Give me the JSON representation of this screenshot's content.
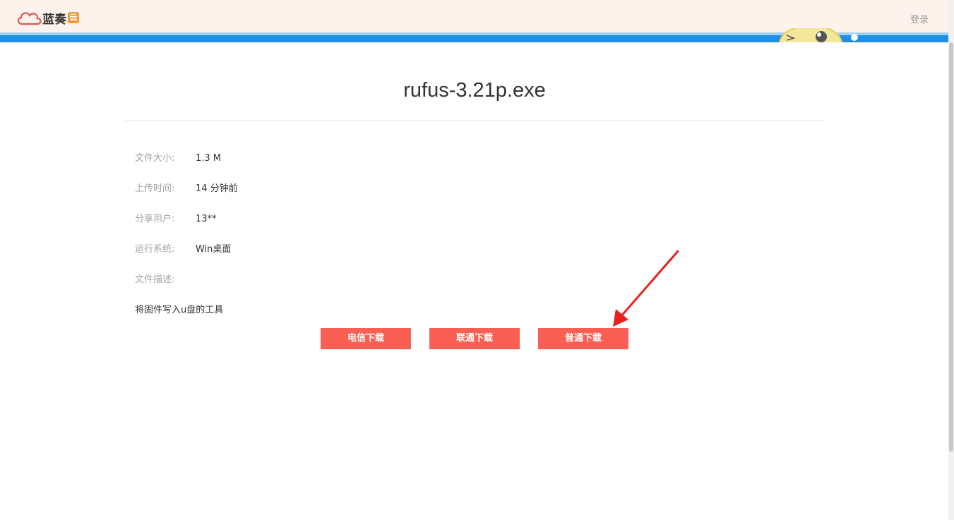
{
  "header": {
    "brand": "蓝奏",
    "brand_badge": "云",
    "login": "登录",
    "colors": {
      "bar": "#fdf3ec",
      "band": "#1e8ee6",
      "logo_red": "#e8544f",
      "badge": "#f39a3c"
    }
  },
  "file": {
    "name": "rufus-3.21p.exe",
    "info": [
      {
        "label": "文件大小:",
        "value": "1.3 M"
      },
      {
        "label": "上传时间:",
        "value": "14 分钟前"
      },
      {
        "label": "分享用户:",
        "value": "13**"
      },
      {
        "label": "运行系统:",
        "value": "Win桌面"
      },
      {
        "label": "文件描述:",
        "value": ""
      }
    ],
    "description": "将固件写入u盘的工具"
  },
  "buttons": {
    "telecom": "电信下载",
    "unicom": "联通下载",
    "normal": "普通下载",
    "color": "#f95f53"
  },
  "annotation": {
    "arrow_color": "#e8211e"
  }
}
